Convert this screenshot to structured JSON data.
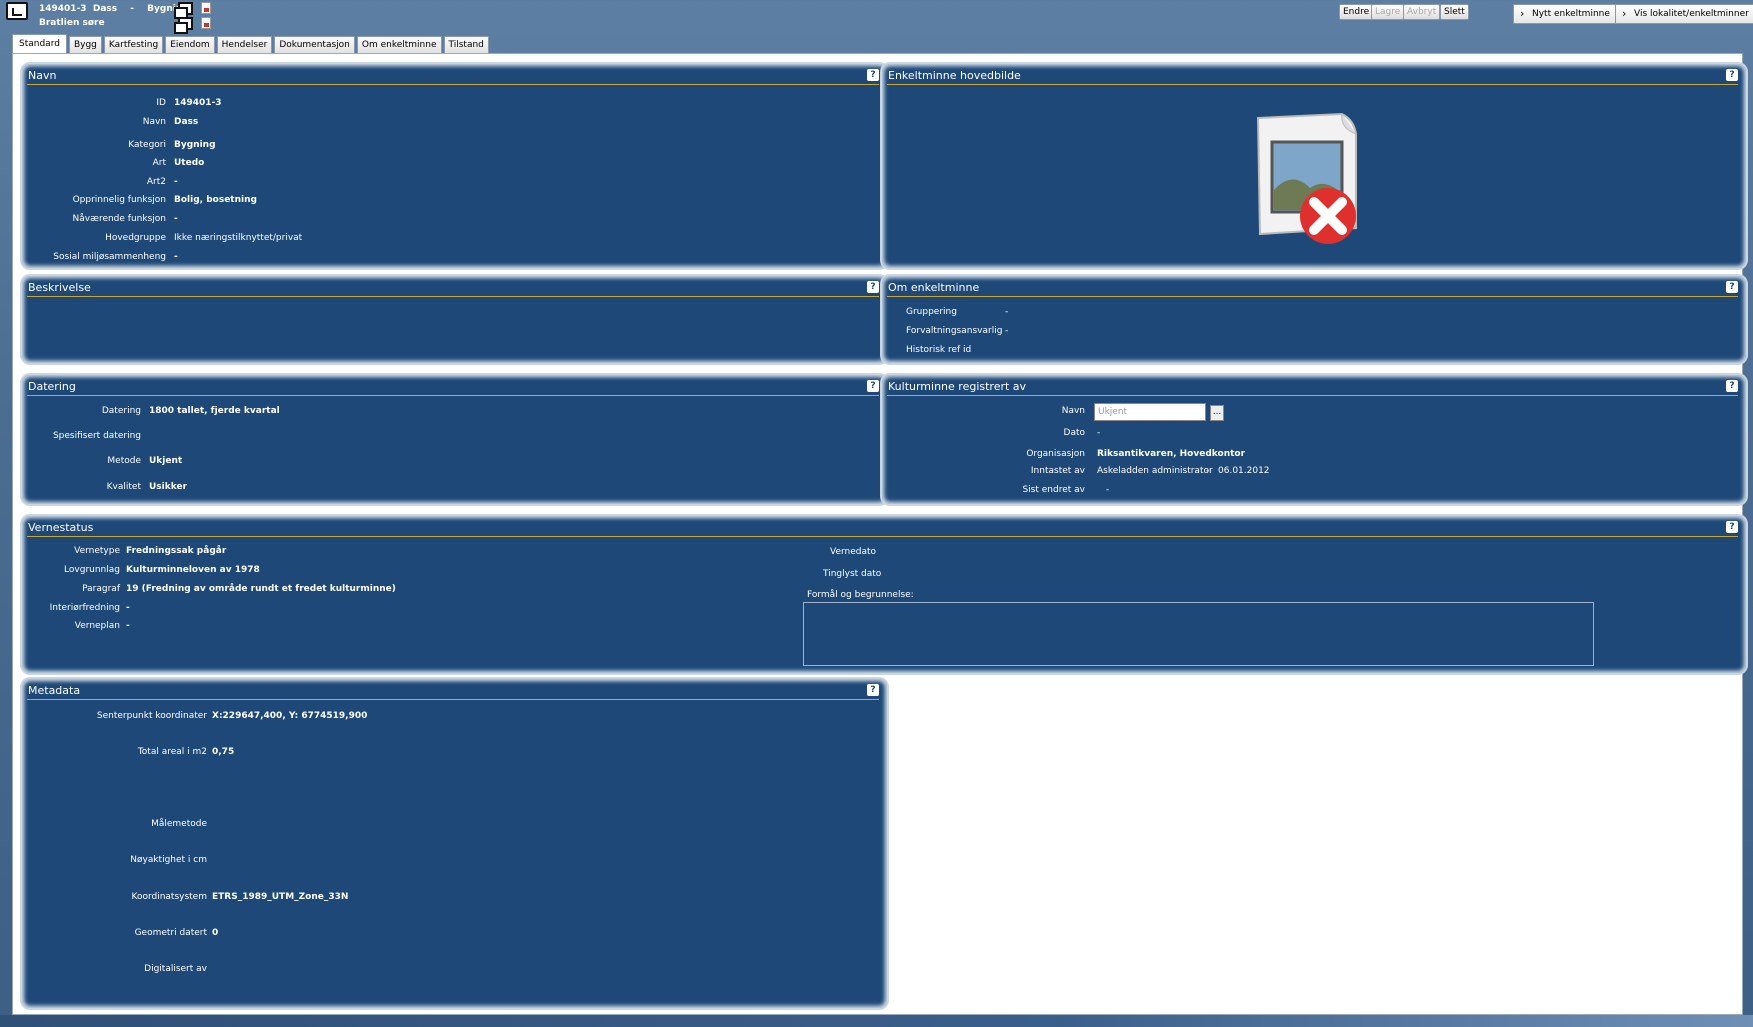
{
  "header": {
    "id": "149401-3",
    "name": "Dass",
    "dash": "-",
    "category": "Bygning",
    "location": "Bratlien søre"
  },
  "toolbar": {
    "endre": "Endre",
    "lagre": "Lagre",
    "avbryt": "Avbryt",
    "slett": "Slett",
    "nytt": "Nytt enkeltminne",
    "vis": "Vis lokalitet/enkeltminner"
  },
  "tabs": [
    "Standard",
    "Bygg",
    "Kartfesting",
    "Eiendom",
    "Hendelser",
    "Dokumentasjon",
    "Om enkeltminne",
    "Tilstand"
  ],
  "navn": {
    "title": "Navn",
    "rows": [
      {
        "label": "ID",
        "value": "149401-3"
      },
      {
        "label": "Navn",
        "value": "Dass"
      },
      {
        "label": "Kategori",
        "value": "Bygning"
      },
      {
        "label": "Art",
        "value": "Utedo"
      },
      {
        "label": "Art2",
        "value": "-"
      },
      {
        "label": "Opprinnelig funksjon",
        "value": "Bolig, bosetning"
      },
      {
        "label": "Nåværende funksjon",
        "value": "-"
      },
      {
        "label": "Hovedgruppe",
        "value": "Ikke næringstilknyttet/privat"
      },
      {
        "label": "Sosial miljøsammenheng",
        "value": "-"
      }
    ]
  },
  "hovedbilde": {
    "title": "Enkeltminne hovedbilde"
  },
  "beskrivelse": {
    "title": "Beskrivelse"
  },
  "om": {
    "title": "Om enkeltminne",
    "rows": [
      {
        "label": "Gruppering",
        "value": "-"
      },
      {
        "label": "Forvaltningsansvarlig",
        "value": "-"
      },
      {
        "label": "Historisk ref id",
        "value": ""
      }
    ]
  },
  "datering": {
    "title": "Datering",
    "rows": [
      {
        "label": "Datering",
        "value": "1800 tallet, fjerde kvartal"
      },
      {
        "label": "Spesifisert datering",
        "value": ""
      },
      {
        "label": "Metode",
        "value": "Ukjent"
      },
      {
        "label": "Kvalitet",
        "value": "Usikker"
      }
    ]
  },
  "registrert": {
    "title": "Kulturminne registrert av",
    "navn_label": "Navn",
    "navn_placeholder": "Ukjent",
    "dots": "...",
    "dato_label": "Dato",
    "dato_value": "-",
    "org_label": "Organisasjon",
    "org_value": "Riksantikvaren, Hovedkontor",
    "inntastet_label": "Inntastet av",
    "inntastet_value": "Askeladden administrator",
    "inntastet_dash": "-",
    "inntastet_date": "06.01.2012",
    "endret_label": "Sist endret av",
    "endret_value": "-"
  },
  "vernestatus": {
    "title": "Vernestatus",
    "rows": [
      {
        "label": "Vernetype",
        "value": "Fredningssak pågår"
      },
      {
        "label": "Lovgrunnlag",
        "value": "Kulturminneloven av 1978"
      },
      {
        "label": "Paragraf",
        "value": "19 (Fredning av område rundt et fredet kulturminne)"
      },
      {
        "label": "Interiørfredning",
        "value": "-"
      },
      {
        "label": "Verneplan",
        "value": "-"
      }
    ],
    "vernedato_label": "Vernedato",
    "tinglyst_label": "Tinglyst dato",
    "formal_label": "Formål og begrunnelse:"
  },
  "metadata": {
    "title": "Metadata",
    "rows": [
      {
        "label": "Senterpunkt koordinater",
        "value": "X:229647,400, Y: 6774519,900"
      },
      {
        "label": "Total areal i m2",
        "value": "0,75"
      },
      {
        "label": "Målemetode",
        "value": ""
      },
      {
        "label": "Nøyaktighet i cm",
        "value": ""
      },
      {
        "label": "Koordinatsystem",
        "value": "ETRS_1989_UTM_Zone_33N"
      },
      {
        "label": "Geometri datert",
        "value": "0"
      },
      {
        "label": "Digitalisert av",
        "value": ""
      }
    ]
  },
  "help": "?"
}
